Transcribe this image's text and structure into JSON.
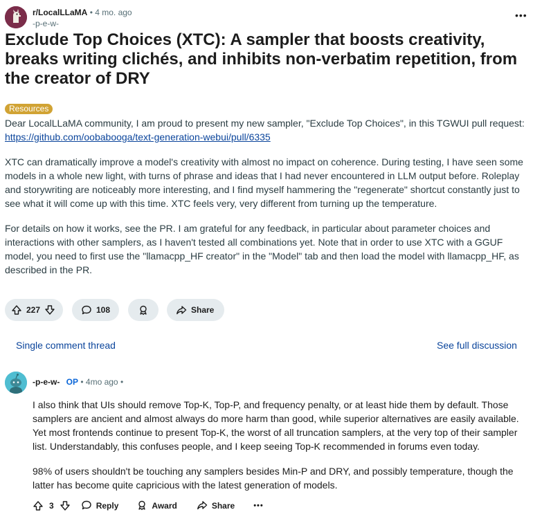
{
  "post": {
    "subreddit": "r/LocalLLaMA",
    "separator": "•",
    "time": "4 mo. ago",
    "author": "-p-e-w-",
    "more": "•••",
    "title": "Exclude Top Choices (XTC): A sampler that boosts creativity, breaks writing clichés, and inhibits non-verbatim repetition, from the creator of DRY",
    "flair": "Resources",
    "p1_text": "Dear LocalLLaMA community, I am proud to present my new sampler, \"Exclude Top Choices\", in this TGWUI pull request:",
    "p1_link": "https://github.com/oobabooga/text-generation-webui/pull/6335",
    "p2": "XTC can dramatically improve a model's creativity with almost no impact on coherence. During testing, I have seen some models in a whole new light, with turns of phrase and ideas that I had never encountered in LLM output before. Roleplay and storywriting are noticeably more interesting, and I find myself hammering the \"regenerate\" shortcut constantly just to see what it will come up with this time. XTC feels very, very different from turning up the temperature.",
    "p3": "For details on how it works, see the PR. I am grateful for any feedback, in particular about parameter choices and interactions with other samplers, as I haven't tested all combinations yet. Note that in order to use XTC with a GGUF model, you need to first use the \"llamacpp_HF creator\" in the \"Model\" tab and then load the model with llamacpp_HF, as described in the PR."
  },
  "actions": {
    "votes": "227",
    "comments": "108",
    "share": "Share"
  },
  "thread": {
    "single": "Single comment thread",
    "full": "See full discussion"
  },
  "comment": {
    "author": "-p-e-w-",
    "op": "OP",
    "separator": "•",
    "time": "4mo ago",
    "trail": "•",
    "p1": "I also think that UIs should remove Top-K, Top-P, and frequency penalty, or at least hide them by default. Those samplers are ancient and almost always do more harm than good, while superior alternatives are easily available. Yet most frontends continue to present Top-K, the worst of all truncation samplers, at the very top of their sampler list. Understandably, this confuses people, and I keep seeing Top-K recommended in forums even today.",
    "p2": "98% of users shouldn't be touching any samplers besides Min-P and DRY, and possibly temperature, though the latter has become quite capricious with the latest generation of models.",
    "votes": "3",
    "reply": "Reply",
    "award": "Award",
    "share": "Share",
    "more": "•••"
  },
  "colors": {
    "flair_bg": "#d1a334",
    "link": "#0a449b",
    "op": "#0a66d8",
    "pill_bg": "#e5ebee",
    "sub_avatar": "#7b2d4a",
    "user_avatar": "#4fbdd1"
  },
  "icons": [
    "subreddit-avatar-icon",
    "more-options-icon",
    "upvote-icon",
    "downvote-icon",
    "comment-icon",
    "award-icon",
    "share-icon",
    "user-avatar-icon",
    "reply-icon"
  ]
}
